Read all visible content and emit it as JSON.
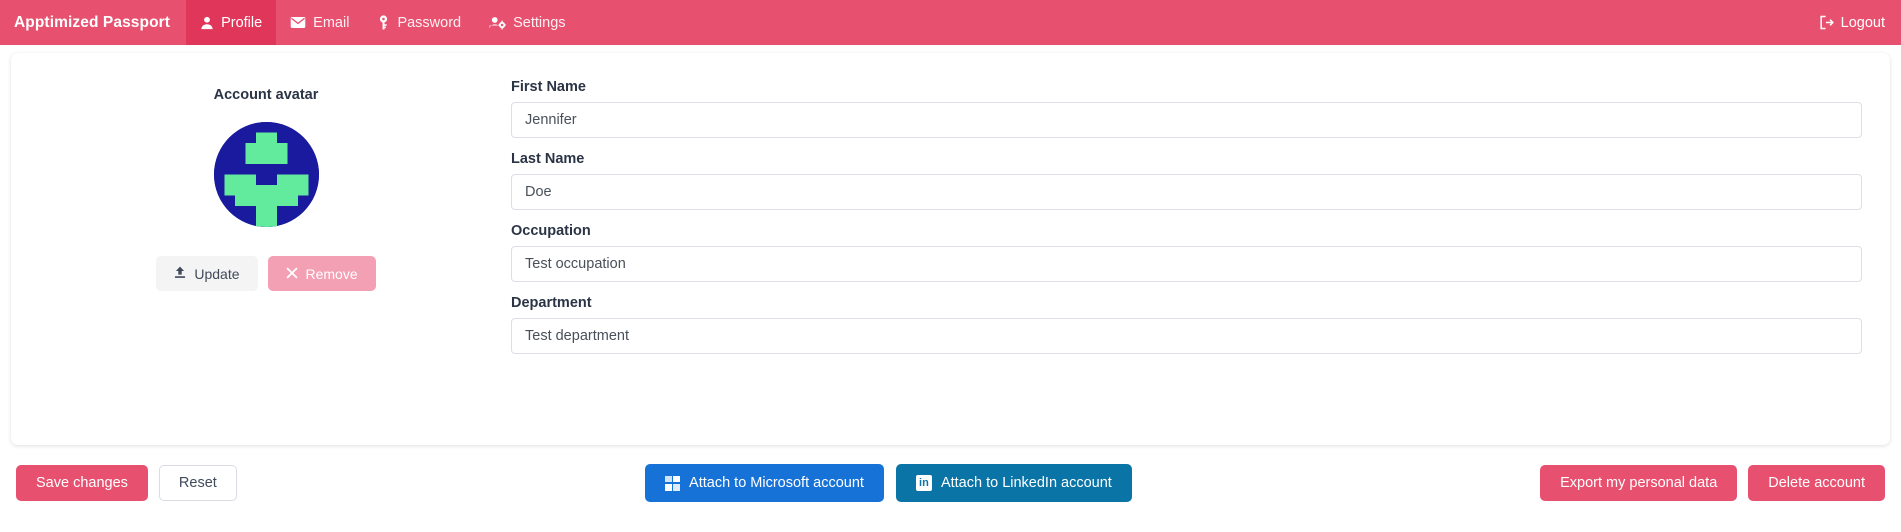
{
  "navbar": {
    "brand": "Apptimized Passport",
    "items": [
      {
        "label": "Profile",
        "icon": "user-icon",
        "active": true
      },
      {
        "label": "Email",
        "icon": "envelope-icon",
        "active": false
      },
      {
        "label": "Password",
        "icon": "key-icon",
        "active": false
      },
      {
        "label": "Settings",
        "icon": "user-gear-icon",
        "active": false
      }
    ],
    "logout_label": "Logout",
    "logout_icon": "sign-out-icon",
    "bg_color": "#e8506f",
    "active_bg_color": "#e0365a"
  },
  "avatar": {
    "title": "Account avatar",
    "icon": "identicon-avatar",
    "bg_color": "#1a1a9e",
    "fg_color": "#63eb9d",
    "update_label": "Update",
    "update_icon": "upload-icon",
    "remove_label": "Remove",
    "remove_icon": "close-x-icon"
  },
  "form": {
    "fields": [
      {
        "label": "First Name",
        "value": "Jennifer",
        "placeholder": "First Name"
      },
      {
        "label": "Last Name",
        "value": "Doe",
        "placeholder": "Last Name"
      },
      {
        "label": "Occupation",
        "value": "Test occupation",
        "placeholder": "Occupation"
      },
      {
        "label": "Department",
        "value": "Test department",
        "placeholder": "Department"
      }
    ]
  },
  "bottom_bar": {
    "save_label": "Save changes",
    "reset_label": "Reset",
    "microsoft_label": "Attach to Microsoft account",
    "microsoft_icon": "microsoft-windows-icon",
    "microsoft_color": "#1672d6",
    "linkedin_label": "Attach to LinkedIn account",
    "linkedin_icon": "linkedin-icon",
    "linkedin_color": "#0a74a6",
    "export_label": "Export my personal data",
    "delete_label": "Delete account",
    "accent_color": "#e8506f"
  }
}
